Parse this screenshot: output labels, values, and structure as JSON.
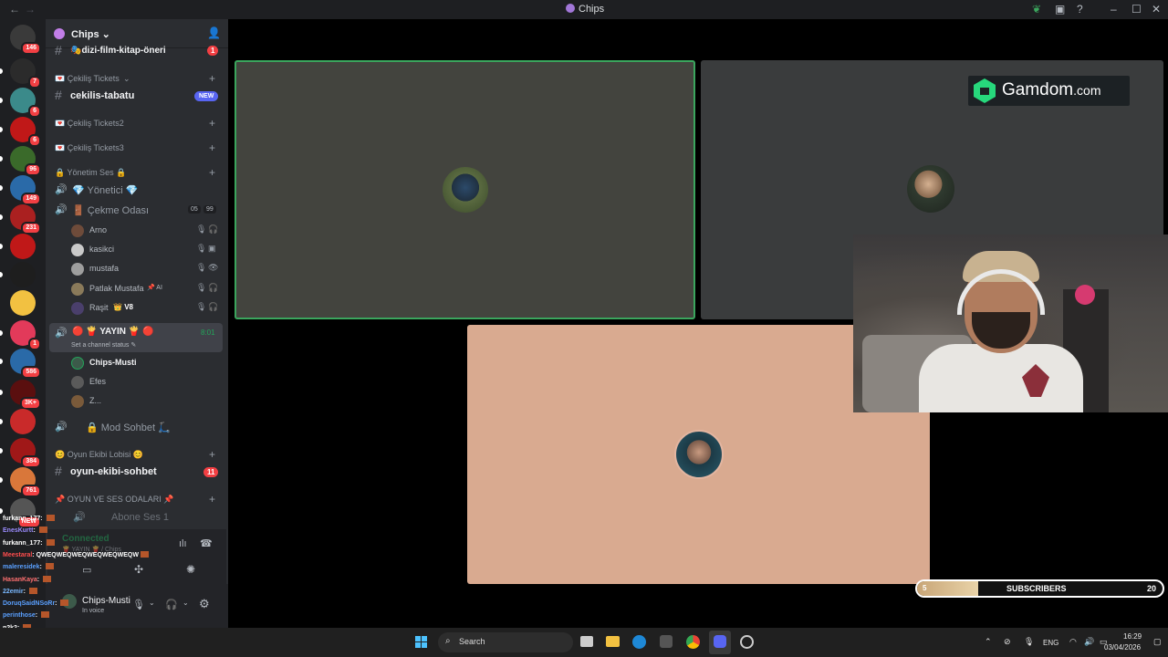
{
  "window": {
    "title": "Chips",
    "nav_back": "←",
    "nav_fwd": "→",
    "min": "–",
    "max": "☐",
    "close": "✕"
  },
  "servers": [
    {
      "badge": "146"
    },
    {
      "badge": "7"
    },
    {
      "badge": "6"
    },
    {
      "badge": "6"
    },
    {
      "badge": "96"
    },
    {
      "badge": "149"
    },
    {
      "badge": "231"
    },
    {
      "badge": ""
    },
    {
      "badge": ""
    },
    {
      "badge": ""
    },
    {
      "badge": "1"
    },
    {
      "badge": "586"
    },
    {
      "badge": "3K+"
    },
    {
      "badge": ""
    },
    {
      "badge": "384"
    },
    {
      "badge": "761"
    },
    {
      "badge": "NEW"
    }
  ],
  "sidebar": {
    "server_name": "Chips",
    "top_channel": "🎭dizi-film-kitap-öneri",
    "top_channel_badge": "1",
    "items": [
      {
        "kind": "cat",
        "label": "💌 Çekiliş Tickets"
      },
      {
        "kind": "chan",
        "label": "cekilis-tabatu",
        "badge_new": "NEW"
      },
      {
        "kind": "cat",
        "label": "💌 Çekiliş Tickets2"
      },
      {
        "kind": "cat",
        "label": "💌 Çekiliş Tickets3"
      },
      {
        "kind": "cat",
        "label": "🔒 Yönetim Ses 🔒"
      },
      {
        "kind": "voice",
        "label": "💎 Yönetici 💎"
      },
      {
        "kind": "voice",
        "label": "🚪 Çekme Odası",
        "count_a": "05",
        "count_b": "99"
      }
    ],
    "users_cekme": [
      "Arno",
      "kasikci",
      "mustafa",
      "Patlak Mustafa",
      "Raşit"
    ],
    "user_tag_patlak": "📌 AI",
    "user_tag_rasit": "V8",
    "live_channel": "🔴 🍟 YAYIN 🍟 🔴",
    "live_time": "8:01",
    "live_status": "Set a channel status",
    "users_live": [
      "Chips-Musti",
      "Efes",
      "Z..."
    ],
    "mod_channel": "🔒 Mod Sohbet 🛴",
    "oyun_cat": "😊 Oyun Ekibi Lobisi 😊",
    "oyun_chan": "oyun-ekibi-sohbet",
    "oyun_badge": "11",
    "oyun_voice_cat": "📌 OYUN VE SES ODALARI 📌",
    "abone_ses": "Abone Ses 1"
  },
  "voice_panel": {
    "status": "Connected",
    "sub": "🍟 YAYIN 🍟 / Chips"
  },
  "user_panel": {
    "name": "Chips-Musti",
    "status": "In voice"
  },
  "ad": {
    "brand": "Gamdom",
    "tld": ".com"
  },
  "subscribers": {
    "label": "SUBSCRIBERS",
    "current": "5",
    "goal": "20",
    "progress": 0.25
  },
  "chat": [
    {
      "user": "furkann_177",
      "msg": "",
      "color": "#ffffff"
    },
    {
      "user": "EnesKurtt",
      "msg": "",
      "color": "#9b8cff"
    },
    {
      "user": "furkann_177",
      "msg": "",
      "color": "#ffffff"
    },
    {
      "user": "Meestaral",
      "msg": "QWEQWEQWEQWEQWEQWEQW",
      "color": "#ff4d4d"
    },
    {
      "user": "maleresidek",
      "msg": "",
      "color": "#5aa0ff"
    },
    {
      "user": "HasanKaya",
      "msg": "",
      "color": "#ff7070"
    },
    {
      "user": "22emir",
      "msg": "",
      "color": "#7ab8ff"
    },
    {
      "user": "DoruqSaidNSoRr",
      "msg": "",
      "color": "#5aa0ff"
    },
    {
      "user": "perinthose",
      "msg": "",
      "color": "#5aa0ff"
    },
    {
      "user": "n2k2",
      "msg": "",
      "color": "#ffffff"
    },
    {
      "user": "TheSelo",
      "msg": "",
      "color": "#7ab8ff"
    }
  ],
  "taskbar": {
    "search": "Search",
    "lang": "ENG",
    "time": "16:29",
    "date": "03/04/2026"
  },
  "colors": {
    "speaking_border": "#3ba55d",
    "tile1": "#43443e",
    "tile2": "#3a3c3d",
    "tile3": "#d9aa90",
    "gamdom_green": "#27d87c"
  }
}
